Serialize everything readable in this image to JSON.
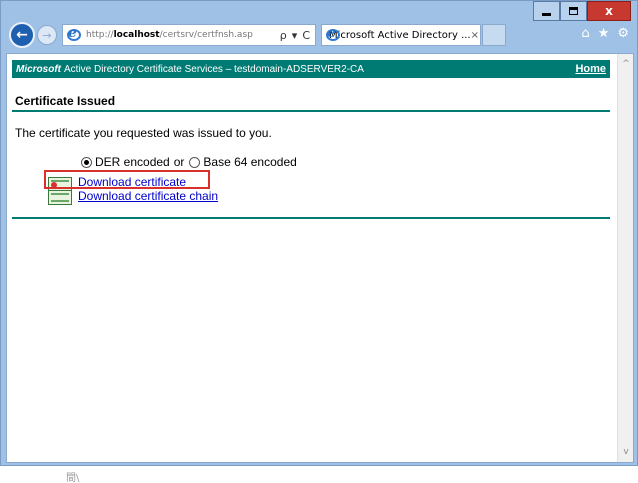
{
  "browser": {
    "address_url_prefix": "http://",
    "address_url_host": "localhost",
    "address_url_path": "/certsrv/certfnsh.asp",
    "search_glyph": "ρ",
    "dropdown_glyph": "▾",
    "refresh_glyph": "C",
    "tab_title": "Microsoft Active Directory ...",
    "tab_close_glyph": "×",
    "back_glyph": "←",
    "forward_glyph": "→",
    "home_glyph": "⌂",
    "favorites_glyph": "★",
    "settings_glyph": "⚙",
    "close_glyph": "x"
  },
  "banner": {
    "brand": "Microsoft",
    "title": "Active Directory Certificate Services  –  testdomain-ADSERVER2-CA",
    "home_link": "Home"
  },
  "page": {
    "heading": "Certificate Issued",
    "message": "The certificate you requested was issued to you.",
    "encoding": {
      "der_label": "DER encoded",
      "or_label": "or",
      "base64_label": "Base 64 encoded",
      "selected": "DER encoded"
    },
    "download_certificate": "Download certificate",
    "download_chain": "Download certificate chain"
  },
  "scrollbar": {
    "up_glyph": "^",
    "down_glyph": "v"
  },
  "below_window_text": "間\\",
  "colors": {
    "banner_teal": "#007b74",
    "link_blue": "#0000cc",
    "highlight_red": "#d9302b",
    "close_red": "#c7382e"
  },
  "icons": [
    "back-icon",
    "forward-icon",
    "ie-logo-icon",
    "search-icon",
    "refresh-icon",
    "home-icon",
    "favorites-star-icon",
    "settings-gear-icon",
    "certificate-icon"
  ]
}
